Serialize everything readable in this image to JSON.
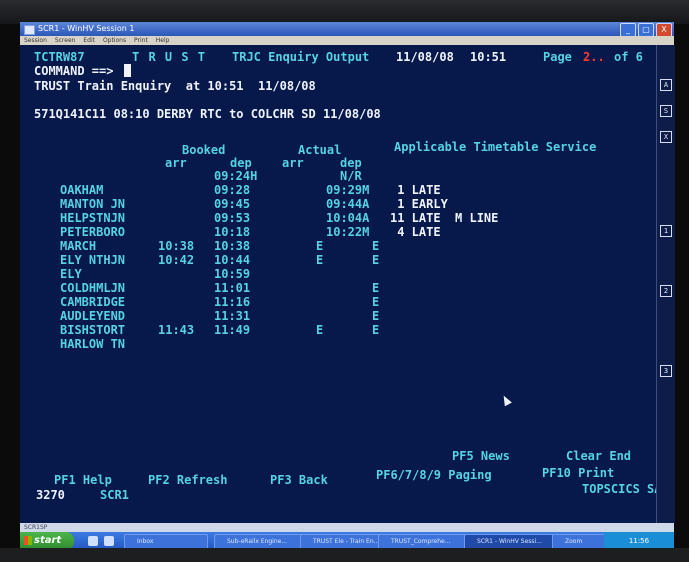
{
  "window": {
    "title": "SCR1 - WinHV Session 1",
    "menu": [
      "Session",
      "Screen",
      "Edit",
      "Options",
      "Print",
      "Help"
    ],
    "buttons": [
      "_",
      "▢",
      "X"
    ],
    "side_markers": [
      "A",
      "S",
      "X",
      "1",
      "2",
      "3"
    ]
  },
  "header": {
    "screen_id": "TCTRW87",
    "system": "T R U S T",
    "function": "TRJC Enquiry Output",
    "date": "11/08/08",
    "time": "10:51",
    "page_prefix": "Page",
    "page_current": "2..",
    "page_suffix": "of 6"
  },
  "command": {
    "prompt": "COMMAND ==>",
    "value": ""
  },
  "enquiry_line": "TRUST Train Enquiry  at 10:51  11/08/08",
  "train_line": "571Q141C11 08:10 DERBY RTC to COLCHR SD 11/08/08",
  "table": {
    "group_booked": "Booked",
    "group_actual": "Actual",
    "group_service": "Applicable Timetable Service",
    "col_arr": "arr",
    "col_dep": "dep",
    "rows": [
      {
        "location": "OAKHAM",
        "b_arr": "",
        "b_dep": "09:24H",
        "a_arr": "",
        "a_dep": "N/R",
        "note": ""
      },
      {
        "location": "MANTON JN",
        "b_arr": "",
        "b_dep": "09:28",
        "a_arr": "",
        "a_dep": "09:29M",
        "note": " 1 LATE"
      },
      {
        "location": "HELPSTNJN",
        "b_arr": "",
        "b_dep": "09:45",
        "a_arr": "",
        "a_dep": "09:44A",
        "note": " 1 EARLY"
      },
      {
        "location": "PETERBORO",
        "b_arr": "",
        "b_dep": "09:53",
        "a_arr": "",
        "a_dep": "10:04A",
        "note": "11 LATE  M LINE"
      },
      {
        "location": "MARCH",
        "b_arr": "",
        "b_dep": "10:18",
        "a_arr": "",
        "a_dep": "10:22M",
        "note": " 4 LATE"
      },
      {
        "location": "ELY NTHJN",
        "b_arr": "10:38",
        "b_dep": "10:38",
        "a_arr": "E",
        "a_dep": "E",
        "note": ""
      },
      {
        "location": "ELY",
        "b_arr": "10:42",
        "b_dep": "10:44",
        "a_arr": "E",
        "a_dep": "E",
        "note": ""
      },
      {
        "location": "COLDHMLJN",
        "b_arr": "",
        "b_dep": "10:59",
        "a_arr": "",
        "a_dep": "",
        "note": ""
      },
      {
        "location": "CAMBRIDGE",
        "b_arr": "",
        "b_dep": "11:01",
        "a_arr": "",
        "a_dep": "E",
        "note": ""
      },
      {
        "location": "AUDLEYEND",
        "b_arr": "",
        "b_dep": "11:16",
        "a_arr": "",
        "a_dep": "E",
        "note": ""
      },
      {
        "location": "BISHSTORT",
        "b_arr": "",
        "b_dep": "11:31",
        "a_arr": "",
        "a_dep": "E",
        "note": ""
      },
      {
        "location": "HARLOW TN",
        "b_arr": "11:43",
        "b_dep": "11:49",
        "a_arr": "E",
        "a_dep": "E",
        "note": ""
      }
    ]
  },
  "pf": {
    "pf1": "PF1 Help",
    "pf2": "PF2 Refresh",
    "pf3": "PF3 Back",
    "pf5": "PF5 News",
    "pf6": "PF6/7/8/9 Paging",
    "clear": "Clear End",
    "pf10": "PF10 Print"
  },
  "footer": {
    "terminal": "3270",
    "session": "SCR1",
    "product": "TOPSCICS SA"
  },
  "statusbar": "SCR1SP",
  "taskbar": {
    "start": "start",
    "items": [
      "Inbox",
      "Sub-eRailx Engine...",
      "TRUST Ele - Train En...",
      "TRUST_Comprehe...",
      "SCR1 - WinHV Sessi...",
      "Zoom"
    ],
    "clock": "11:56"
  }
}
